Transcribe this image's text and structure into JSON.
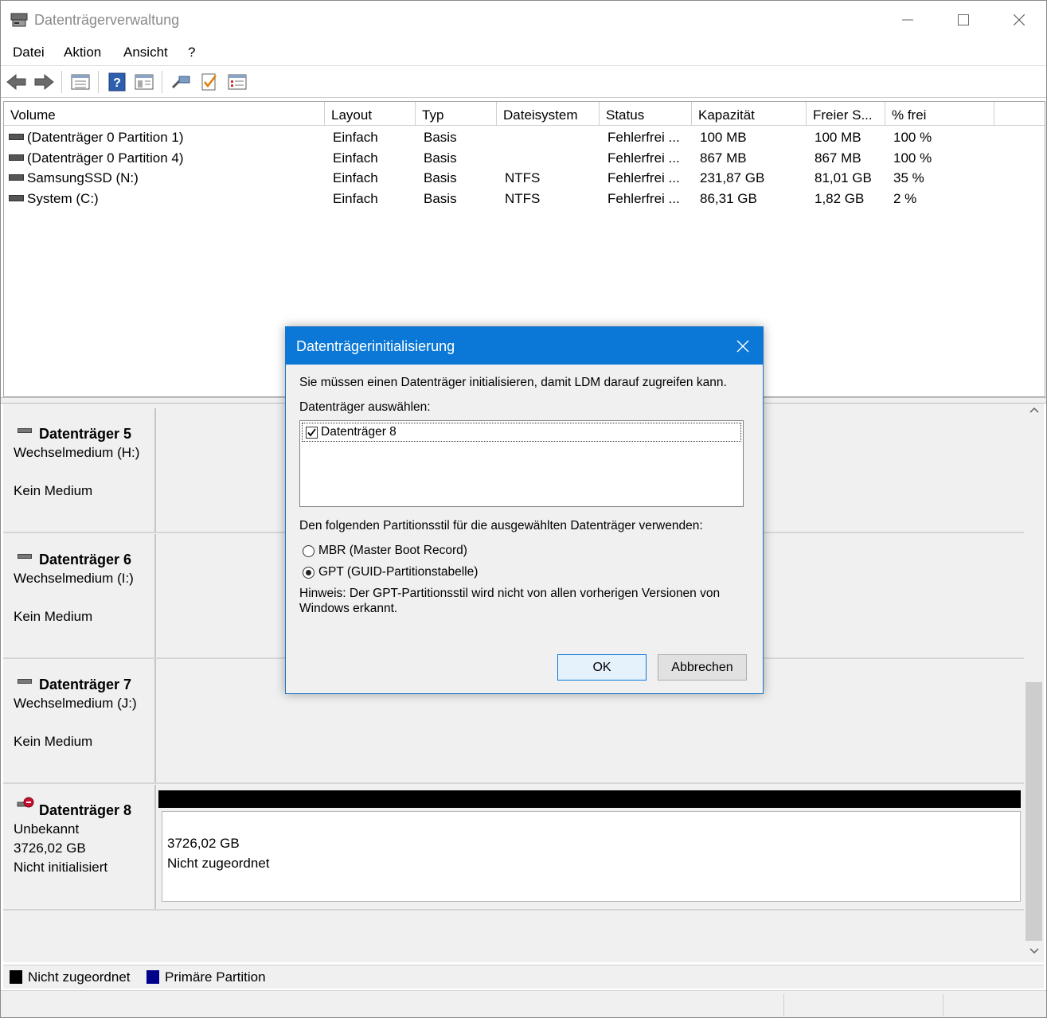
{
  "window": {
    "title": "Datenträgerverwaltung",
    "minimize_icon": "minimize-icon",
    "maximize_icon": "maximize-icon",
    "close_icon": "close-icon"
  },
  "menu": [
    "Datei",
    "Aktion",
    "Ansicht",
    "?"
  ],
  "toolbar": {
    "icons": [
      "back-arrow-icon",
      "forward-arrow-icon",
      "list-view-icon",
      "help-icon",
      "properties-icon",
      "connect-icon",
      "check-icon",
      "details-icon"
    ]
  },
  "volumes": {
    "columns": [
      "Volume",
      "Layout",
      "Typ",
      "Dateisystem",
      "Status",
      "Kapazität",
      "Freier S...",
      "% frei"
    ],
    "rows": [
      [
        "(Datenträger 0 Partition 1)",
        "Einfach",
        "Basis",
        "",
        "Fehlerfrei ...",
        "100 MB",
        "100 MB",
        "100 %"
      ],
      [
        "(Datenträger 0 Partition 4)",
        "Einfach",
        "Basis",
        "",
        "Fehlerfrei ...",
        "867 MB",
        "867 MB",
        "100 %"
      ],
      [
        "SamsungSSD (N:)",
        "Einfach",
        "Basis",
        "NTFS",
        "Fehlerfrei ...",
        "231,87 GB",
        "81,01 GB",
        "35 %"
      ],
      [
        "System (C:)",
        "Einfach",
        "Basis",
        "NTFS",
        "Fehlerfrei ...",
        "86,31 GB",
        "1,82 GB",
        "2 %"
      ]
    ]
  },
  "disks": [
    {
      "name": "Datenträger 5",
      "type": "Wechselmedium (H:)",
      "state": "Kein Medium"
    },
    {
      "name": "Datenträger 6",
      "type": "Wechselmedium (I:)",
      "state": "Kein Medium"
    },
    {
      "name": "Datenträger 7",
      "type": "Wechselmedium (J:)",
      "state": "Kein Medium"
    },
    {
      "name": "Datenträger 8",
      "type": "Unbekannt",
      "size": "3726,02 GB",
      "state": "Nicht initialisiert",
      "partition": {
        "size": "3726,02 GB",
        "label": "Nicht zugeordnet"
      }
    }
  ],
  "legend": [
    {
      "label": "Nicht zugeordnet",
      "color": "#000000"
    },
    {
      "label": "Primäre Partition",
      "color": "#00008b"
    }
  ],
  "dialog": {
    "title": "Datenträgerinitialisierung",
    "intro": "Sie müssen einen Datenträger initialisieren, damit LDM darauf zugreifen kann.",
    "select_label": "Datenträger auswählen:",
    "disk_item": "Datenträger 8",
    "disk_checked": true,
    "style_label": "Den folgenden Partitionsstil für die ausgewählten Datenträger verwenden:",
    "option_mbr": "MBR (Master Boot Record)",
    "option_gpt": "GPT (GUID-Partitionstabelle)",
    "selected_option": "GPT",
    "hint_line1": "Hinweis: Der GPT-Partitionsstil wird nicht von allen vorherigen Versionen von",
    "hint_line2": "Windows erkannt.",
    "ok": "OK",
    "cancel": "Abbrechen"
  },
  "colors": {
    "dialog_title_bar": "#0b78d7",
    "accent": "#0b78d7"
  }
}
